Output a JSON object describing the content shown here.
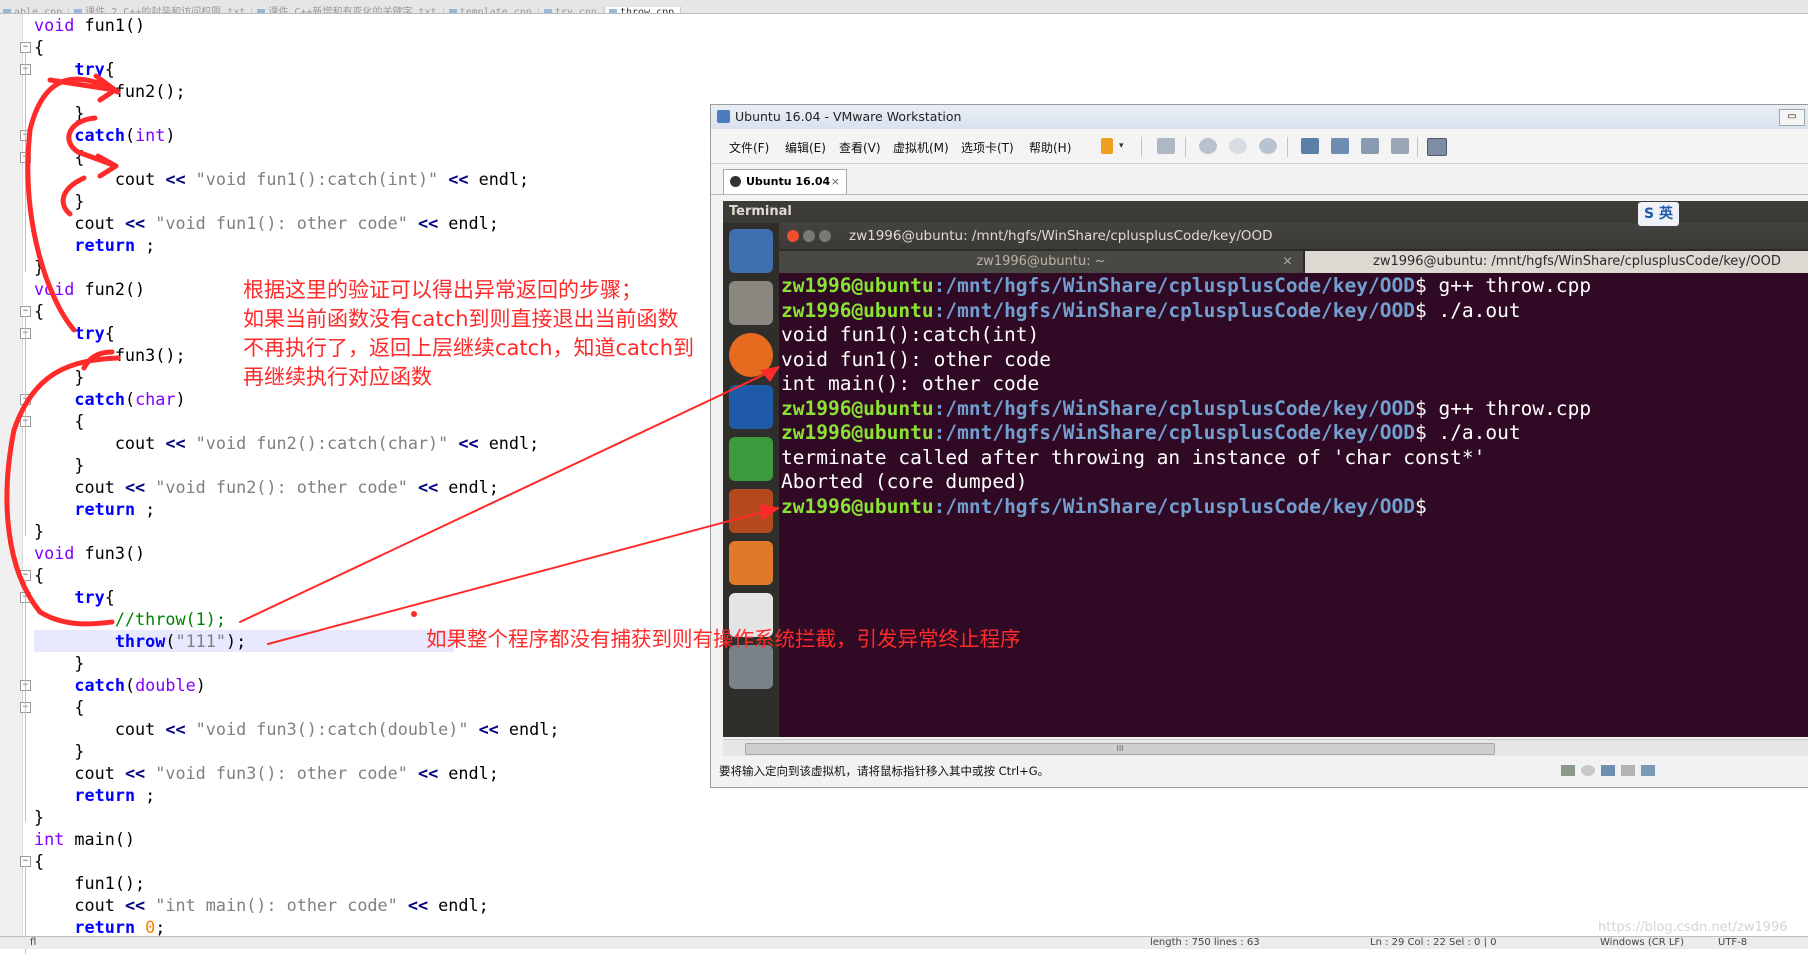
{
  "editor": {
    "tabs": [
      "able.cpp",
      "课件_2.C++的封装和访问权限.txt",
      "课件_C++新增和有变化的关键字.txt",
      "template.cpp",
      "try.cpp",
      "throw.cpp"
    ],
    "code_lines": [
      {
        "html": "<span class=\"ty\">void</span> fun1()"
      },
      {
        "html": "{"
      },
      {
        "html": "    <span class=\"kw\">try</span>{"
      },
      {
        "html": "        fun2();"
      },
      {
        "html": "    }"
      },
      {
        "html": "    <span class=\"kw\">catch</span>(<span class=\"ty\">int</span>)"
      },
      {
        "html": "    {"
      },
      {
        "html": "        cout <span class=\"op\">&lt;&lt;</span> <span class=\"st\">\"void fun1():catch(int)\"</span> <span class=\"op\">&lt;&lt;</span> endl;"
      },
      {
        "html": "    }"
      },
      {
        "html": "    cout <span class=\"op\">&lt;&lt;</span> <span class=\"st\">\"void fun1(): other code\"</span> <span class=\"op\">&lt;&lt;</span> endl;"
      },
      {
        "html": "    <span class=\"kw\">return</span> ;"
      },
      {
        "html": "}"
      },
      {
        "html": "<span class=\"ty\">void</span> fun2()"
      },
      {
        "html": "{"
      },
      {
        "html": "    <span class=\"kw\">try</span>{"
      },
      {
        "html": "        fun3();"
      },
      {
        "html": "    }"
      },
      {
        "html": "    <span class=\"kw\">catch</span>(<span class=\"ty\">char</span>)"
      },
      {
        "html": "    {"
      },
      {
        "html": "        cout <span class=\"op\">&lt;&lt;</span> <span class=\"st\">\"void fun2():catch(char)\"</span> <span class=\"op\">&lt;&lt;</span> endl;"
      },
      {
        "html": "    }"
      },
      {
        "html": "    cout <span class=\"op\">&lt;&lt;</span> <span class=\"st\">\"void fun2(): other code\"</span> <span class=\"op\">&lt;&lt;</span> endl;"
      },
      {
        "html": "    <span class=\"kw\">return</span> ;"
      },
      {
        "html": "}"
      },
      {
        "html": "<span class=\"ty\">void</span> fun3()"
      },
      {
        "html": "{"
      },
      {
        "html": "    <span class=\"kw\">try</span>{"
      },
      {
        "html": "        <span class=\"cm\">//throw(1);</span>"
      },
      {
        "html": "        <span class=\"kw\">throw</span>(<span class=\"st\">\"111\"</span>);",
        "hl": true
      },
      {
        "html": "    }"
      },
      {
        "html": "    <span class=\"kw\">catch</span>(<span class=\"ty\">double</span>)"
      },
      {
        "html": "    {"
      },
      {
        "html": "        cout <span class=\"op\">&lt;&lt;</span> <span class=\"st\">\"void fun3():catch(double)\"</span> <span class=\"op\">&lt;&lt;</span> endl;"
      },
      {
        "html": "    }"
      },
      {
        "html": "    cout <span class=\"op\">&lt;&lt;</span> <span class=\"st\">\"void fun3(): other code\"</span> <span class=\"op\">&lt;&lt;</span> endl;"
      },
      {
        "html": "    <span class=\"kw\">return</span> ;"
      },
      {
        "html": "}"
      },
      {
        "html": "<span class=\"ty\">int</span> main()"
      },
      {
        "html": "{"
      },
      {
        "html": "    fun1();"
      },
      {
        "html": "    cout <span class=\"op\">&lt;&lt;</span> <span class=\"st\">\"int main(): other code\"</span> <span class=\"op\">&lt;&lt;</span> endl;"
      },
      {
        "html": "    <span class=\"kw\">return</span> <span class=\"nu\">0</span>;"
      }
    ],
    "status": {
      "left": "fl",
      "length": "length : 750    lines : 63",
      "position": "Ln : 29    Col : 22    Sel : 0 | 0",
      "eol": "Windows (CR LF)",
      "encoding": "UTF-8"
    }
  },
  "vmware": {
    "title": "Ubuntu 16.04 - VMware Workstation",
    "menu": [
      "文件(F)",
      "编辑(E)",
      "查看(V)",
      "虚拟机(M)",
      "选项卡(T)",
      "帮助(H)"
    ],
    "tab_label": "Ubuntu 16.04",
    "tab_close": "×",
    "topbar_label": "Terminal",
    "terminal_title": "zw1996@ubuntu: /mnt/hgfs/WinShare/cplusplusCode/key/OOD",
    "terminal_tabs": [
      "zw1996@ubuntu: ~",
      "zw1996@ubuntu: /mnt/hgfs/WinShare/cplusplusCode/key/OOD"
    ],
    "terminal_tab_close": "×",
    "prompt_user": "zw1996@ubuntu",
    "prompt_path": ":/mnt/hgfs/WinShare/cplusplusCode/key/OOD",
    "lines": [
      {
        "prompt": true,
        "text": "$ g++ throw.cpp"
      },
      {
        "prompt": true,
        "text": "$ ./a.out"
      },
      {
        "prompt": false,
        "text": "void fun1():catch(int)"
      },
      {
        "prompt": false,
        "text": "void fun1(): other code"
      },
      {
        "prompt": false,
        "text": "int main(): other code"
      },
      {
        "prompt": true,
        "text": "$ g++ throw.cpp"
      },
      {
        "prompt": true,
        "text": "$ ./a.out"
      },
      {
        "prompt": false,
        "text": "terminate called after throwing an instance of 'char const*'"
      },
      {
        "prompt": false,
        "text": "Aborted (core dumped)"
      },
      {
        "prompt": true,
        "text": "$"
      }
    ],
    "status_text": "要将输入定向到该虚拟机，请将鼠标指针移入其中或按 Ctrl+G。",
    "scroll_label": "III",
    "restore_label": "▭"
  },
  "annotations": {
    "note1": [
      "根据这里的验证可以得出异常返回的步骤；",
      "如果当前函数没有catch到则直接退出当前函数",
      "不再执行了，返回上层继续catch，知道catch到",
      "再继续执行对应函数"
    ],
    "note2": "如果整个程序都没有捕获到则有操作系统拦截，引发异常终止程序",
    "ime": "S 英",
    "watermark": "https://blog.csdn.net/zw1996"
  },
  "colors": {
    "annotation": "#ff2a2a",
    "terminal_bg": "#300a24",
    "prompt_user": "#8ae234",
    "prompt_path": "#729fcf"
  }
}
